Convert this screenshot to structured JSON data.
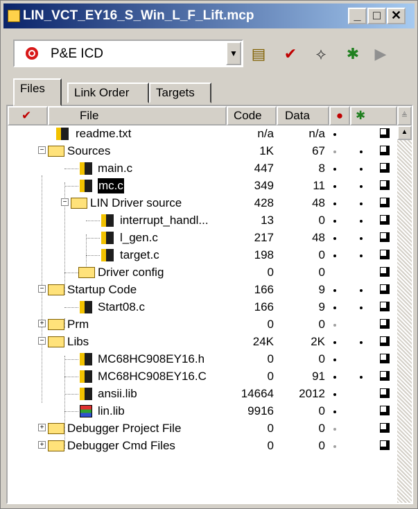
{
  "window": {
    "title": "LIN_VCT_EY16_S_Win_L_F_Lift.mcp",
    "min": "_",
    "max": "□",
    "close": "✕"
  },
  "toolbar": {
    "target": "P&E ICD"
  },
  "tabs": [
    "Files",
    "Link Order",
    "Targets"
  ],
  "headers": {
    "file": "File",
    "code": "Code",
    "data": "Data"
  },
  "rows": [
    {
      "name": "readme.txt",
      "code": "n/a",
      "data": "n/a"
    },
    {
      "name": "Sources",
      "code": "1K",
      "data": "67"
    },
    {
      "name": "main.c",
      "code": "447",
      "data": "8"
    },
    {
      "name": "mc.c",
      "code": "349",
      "data": "11"
    },
    {
      "name": "LIN Driver source",
      "code": "428",
      "data": "48"
    },
    {
      "name": "interrupt_handl...",
      "code": "13",
      "data": "0"
    },
    {
      "name": "l_gen.c",
      "code": "217",
      "data": "48"
    },
    {
      "name": "target.c",
      "code": "198",
      "data": "0"
    },
    {
      "name": "Driver config",
      "code": "0",
      "data": "0"
    },
    {
      "name": "Startup Code",
      "code": "166",
      "data": "9"
    },
    {
      "name": "Start08.c",
      "code": "166",
      "data": "9"
    },
    {
      "name": "Prm",
      "code": "0",
      "data": "0"
    },
    {
      "name": "Libs",
      "code": "24K",
      "data": "2K"
    },
    {
      "name": "MC68HC908EY16.h",
      "code": "0",
      "data": "0"
    },
    {
      "name": "MC68HC908EY16.C",
      "code": "0",
      "data": "91"
    },
    {
      "name": "ansii.lib",
      "code": "14664",
      "data": "2012"
    },
    {
      "name": "lin.lib",
      "code": "9916",
      "data": "0"
    },
    {
      "name": "Debugger Project File",
      "code": "0",
      "data": "0"
    },
    {
      "name": "Debugger Cmd Files",
      "code": "0",
      "data": "0"
    }
  ]
}
